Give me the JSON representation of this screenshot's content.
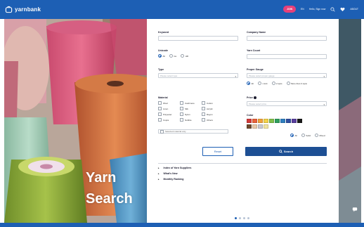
{
  "header": {
    "logo": "yarnbank",
    "nav": [
      "JOIN",
      "EN",
      "Hello, Sign now",
      "ABOUT"
    ]
  },
  "hero": {
    "title_line1": "Yarn",
    "title_line2": "Search"
  },
  "form": {
    "keyword_label": "Keyword",
    "company_label": "Company Name",
    "unicode_label": "Unicode",
    "unicode_options": [
      "All",
      "Gs",
      "HR"
    ],
    "yarn_count_label": "Yarn Count",
    "type_label": "Type",
    "type_placeholder": "Please select type",
    "proper_gauge_label": "Proper Gauge",
    "proper_gauge_placeholder": "Please select proper gauge",
    "gauge_options": [
      "All",
      "1 knit",
      "2 wpis",
      "More than 3 wpis"
    ],
    "material_label": "Material",
    "materials": [
      "Wool",
      "Cashmere",
      "Cotton",
      "Linen",
      "Silk",
      "Acrylic",
      "Polyester",
      "Nylon",
      "Rayon",
      "Cupra",
      "Nubble",
      "Others"
    ],
    "selected_materials": "Selected material only",
    "price_label": "Price",
    "price_placeholder": "Please select price",
    "color_label": "Color",
    "colors": [
      "#d23a3a",
      "#e8623a",
      "#f0a23a",
      "#f2d24a",
      "#7fbf4a",
      "#2f9e5e",
      "#2f7fbf",
      "#2f4fa0",
      "#5a3f9e",
      "#1a1a1a",
      "#6e4a2e",
      "#e8c8a8",
      "#c8c8d0",
      "#f0e4a0"
    ],
    "color_options": [
      "All",
      "Solid",
      "Mixed"
    ],
    "reset_label": "Reset",
    "search_label": "Search"
  },
  "links": [
    "Index of Yarn Suppliers",
    "What's New",
    "Monthly Ranking"
  ],
  "pager": {
    "count": 4,
    "active": 0
  }
}
